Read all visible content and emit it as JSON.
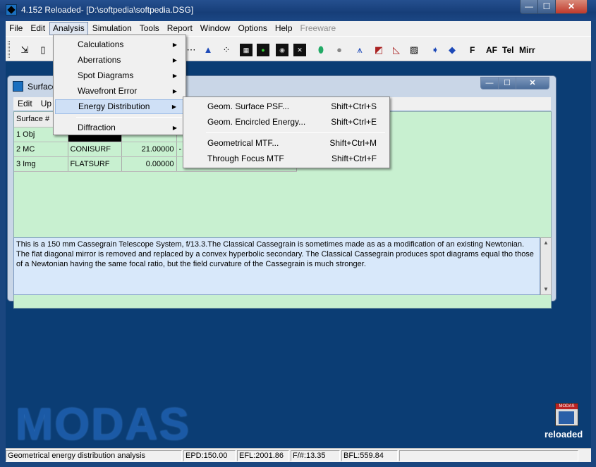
{
  "window": {
    "title": "4.152 Reloaded- [D:\\softpedia\\softpedia.DSG]",
    "min": "—",
    "max": "☐",
    "close": "✕"
  },
  "menubar": [
    "File",
    "Edit",
    "Analysis",
    "Simulation",
    "Tools",
    "Report",
    "Window",
    "Options",
    "Help",
    "Freeware"
  ],
  "toolbar": {
    "text_buttons": [
      "F",
      "AF",
      "Tel",
      "Mirr"
    ]
  },
  "child_window": {
    "title": "Surface",
    "menu": [
      "Edit",
      "Up"
    ],
    "min": "—",
    "max": "☐",
    "close": "✕"
  },
  "table": {
    "header": "Surface #",
    "rows": [
      {
        "surface": "1 Obj",
        "type": "",
        "value": "",
        "extra": ""
      },
      {
        "surface": "2 MC",
        "type": "CONISURF",
        "value": "21.00000",
        "extra": "-"
      },
      {
        "surface": "3 Img",
        "type": "FLATSURF",
        "value": "0.00000",
        "extra": ""
      }
    ]
  },
  "description": "This is a 150 mm Cassegrain Telescope System, f/13.3.The Classical Cassegrain is sometimes made as as a modification of an existing Newtonian. The flat diagonal mirror is removed and replaced by a convex hyperbolic secondary. The Classical Cassegrain produces spot diagrams equal tho those of a Newtonian having the same focal ratio, but the field curvature of the Cassegrain is much stronger.",
  "analysis_menu": {
    "items": [
      "Calculations",
      "Aberrations",
      "Spot Diagrams",
      "Wavefront Error",
      "Energy Distribution",
      "Diffraction"
    ],
    "active": "Energy Distribution"
  },
  "energy_submenu": {
    "items": [
      {
        "label": "Geom. Surface PSF...",
        "shortcut": "Shift+Ctrl+S"
      },
      {
        "label": "Geom. Encircled Energy...",
        "shortcut": "Shift+Ctrl+E"
      },
      {
        "label": "Geometrical MTF...",
        "shortcut": "Shift+Ctrl+M"
      },
      {
        "label": "Through Focus MTF",
        "shortcut": "Shift+Ctrl+F"
      }
    ]
  },
  "branding": {
    "logo_text": "MODAS",
    "small_logo_text": "MODAS",
    "reloaded": "reloaded"
  },
  "status": {
    "message": "Geometrical energy distribution analysis",
    "epd": "EPD:150.00",
    "efl": "EFL:2001.86",
    "fnum": "F/#:13.35",
    "bfl": "BFL:559.84"
  },
  "colors": {
    "desktop": "#0b3d74",
    "grid": "#c8f0d0",
    "description_bg": "#d8e8fa",
    "menu_highlight": "#cfe0f6"
  }
}
